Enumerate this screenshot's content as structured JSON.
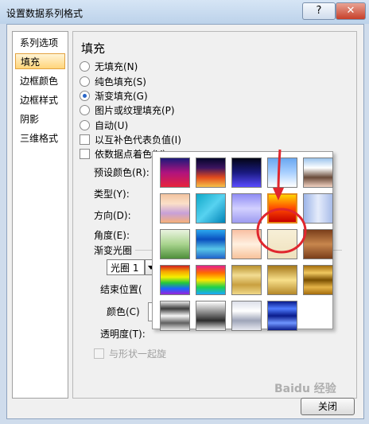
{
  "window": {
    "title": "设置数据系列格式",
    "help_glyph": "?",
    "close_glyph": "✕"
  },
  "sidebar": {
    "items": [
      {
        "label": "系列选项",
        "selected": false
      },
      {
        "label": "填充",
        "selected": true
      },
      {
        "label": "边框颜色",
        "selected": false
      },
      {
        "label": "边框样式",
        "selected": false
      },
      {
        "label": "阴影",
        "selected": false
      },
      {
        "label": "三维格式",
        "selected": false
      }
    ]
  },
  "fill": {
    "heading": "填充",
    "options": [
      {
        "label": "无填充(N)",
        "checked": false
      },
      {
        "label": "纯色填充(S)",
        "checked": false
      },
      {
        "label": "渐变填充(G)",
        "checked": true
      },
      {
        "label": "图片或纹理填充(P)",
        "checked": false
      },
      {
        "label": "自动(U)",
        "checked": false
      }
    ],
    "checkboxes": [
      {
        "label": "以互补色代表负值(I)",
        "checked": false
      },
      {
        "label": "依数据点着色(V)",
        "checked": false
      }
    ],
    "preset_label": "预设颜色(R):",
    "type_label": "类型(Y):",
    "direction_label": "方向(D):",
    "angle_label": "角度(E):",
    "stops_label": "渐变光圈",
    "stop_value": "光圈 1",
    "end_position_label": "结束位置(",
    "color_label": "颜色(C)",
    "transparency_label": "透明度(T):",
    "rotate_label": "与形状一起旋"
  },
  "preset_gallery": {
    "swatches": [
      {
        "name": "early-sunset",
        "colors": [
          "#1d1a7a",
          "#b0137e",
          "#e8243c"
        ],
        "dir": "180deg"
      },
      {
        "name": "late-sunset",
        "colors": [
          "#05062a",
          "#3c1460",
          "#e24a1c",
          "#f6c04a"
        ],
        "dir": "180deg"
      },
      {
        "name": "nightfall",
        "colors": [
          "#030515",
          "#1a1a80",
          "#5a4cff"
        ],
        "dir": "180deg"
      },
      {
        "name": "daybreak",
        "colors": [
          "#6aa7f0",
          "#a9d0ff",
          "#ffffff"
        ],
        "dir": "180deg"
      },
      {
        "name": "horizon",
        "colors": [
          "#9cc4ec",
          "#ffffff",
          "#6a4b3a",
          "#f3d3c2"
        ],
        "dir": "180deg"
      },
      {
        "name": "desert",
        "colors": [
          "#f2c3a0",
          "#fbe0c8",
          "#c7a0d8",
          "#f6b07a"
        ],
        "dir": "180deg"
      },
      {
        "name": "ocean",
        "colors": [
          "#0fa8c8",
          "#57d2f0",
          "#0083b7"
        ],
        "dir": "135deg"
      },
      {
        "name": "calm-water",
        "colors": [
          "#8f8cf4",
          "#d2d0ff",
          "#9d9bf0"
        ],
        "dir": "180deg"
      },
      {
        "name": "fire",
        "colors": [
          "#c60000",
          "#ff4a00",
          "#ffd400"
        ],
        "dir": "0deg"
      },
      {
        "name": "fog",
        "colors": [
          "#9cb4e8",
          "#e5ecfb",
          "#a8bce9"
        ],
        "dir": "90deg"
      },
      {
        "name": "moss",
        "colors": [
          "#4f8f3b",
          "#a9d48e",
          "#e9f3e0"
        ],
        "dir": "0deg"
      },
      {
        "name": "peacock",
        "colors": [
          "#2ba8ef",
          "#0a4fbf",
          "#58c6e8",
          "#2162c9"
        ],
        "dir": "180deg"
      },
      {
        "name": "wheat",
        "colors": [
          "#f9c0a3",
          "#fff0e0",
          "#f8c29b"
        ],
        "dir": "180deg"
      },
      {
        "name": "parchment",
        "colors": [
          "#f7efd7",
          "#efe1bd"
        ],
        "dir": "180deg"
      },
      {
        "name": "mahogany",
        "colors": [
          "#7a3e1a",
          "#c7864d",
          "#7a3e1a"
        ],
        "dir": "180deg"
      },
      {
        "name": "rainbow",
        "colors": [
          "#d11f1f",
          "#f6a400",
          "#f5f000",
          "#23c83a",
          "#1c63ff",
          "#9a24d9"
        ],
        "dir": "180deg"
      },
      {
        "name": "rainbow-2",
        "colors": [
          "#e61f8c",
          "#ff6a00",
          "#ffe400",
          "#1fd14a",
          "#19a9ff"
        ],
        "dir": "180deg"
      },
      {
        "name": "gold",
        "colors": [
          "#b8902e",
          "#f2dd92",
          "#c9a040",
          "#f0d888"
        ],
        "dir": "180deg"
      },
      {
        "name": "gold-2",
        "colors": [
          "#a5771a",
          "#f7df8a",
          "#b58828"
        ],
        "dir": "180deg"
      },
      {
        "name": "brass",
        "colors": [
          "#a46d0c",
          "#f0c860",
          "#7a4f00",
          "#e6b448",
          "#a46d0c"
        ],
        "dir": "180deg"
      },
      {
        "name": "chrome",
        "colors": [
          "#e8e8e8",
          "#3b3b3b",
          "#f5f5f5",
          "#616161",
          "#e8e8e8"
        ],
        "dir": "180deg"
      },
      {
        "name": "chrome-2",
        "colors": [
          "#ffffff",
          "#9a9a9a",
          "#2d2d2d",
          "#f0f0f0"
        ],
        "dir": "180deg"
      },
      {
        "name": "silver",
        "colors": [
          "#dde0ea",
          "#ffffff",
          "#9ea4b8",
          "#e7e9f1"
        ],
        "dir": "180deg"
      },
      {
        "name": "sapphire",
        "colors": [
          "#0a1c8c",
          "#4f7cff",
          "#0a1c8c",
          "#6f95ff",
          "#0a1c8c"
        ],
        "dir": "180deg"
      }
    ]
  },
  "buttons": {
    "close_label": "关闭"
  },
  "watermark": "Baidu 经验"
}
